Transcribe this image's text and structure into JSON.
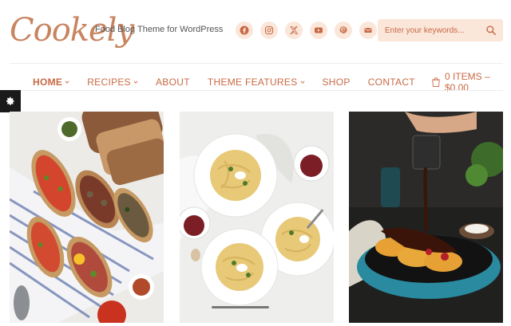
{
  "site": {
    "logo": "Cookely",
    "tagline": "Food Blog Theme for WordPress"
  },
  "socials": [
    {
      "name": "facebook-icon"
    },
    {
      "name": "instagram-icon"
    },
    {
      "name": "x-icon"
    },
    {
      "name": "youtube-icon"
    },
    {
      "name": "pinterest-icon"
    },
    {
      "name": "email-icon"
    }
  ],
  "search": {
    "placeholder": "Enter your keywords..."
  },
  "nav": {
    "items": [
      {
        "label": "HOME",
        "dropdown": true,
        "active": true
      },
      {
        "label": "RECIPES",
        "dropdown": true
      },
      {
        "label": "ABOUT",
        "dropdown": false
      },
      {
        "label": "THEME FEATURES",
        "dropdown": true
      },
      {
        "label": "SHOP",
        "dropdown": false
      },
      {
        "label": "CONTACT",
        "dropdown": false
      }
    ],
    "cart_label": "0 ITEMS – $0.00"
  },
  "colors": {
    "accent": "#c96a45",
    "accent_light": "#fbe6da",
    "logo": "#c8845f"
  }
}
